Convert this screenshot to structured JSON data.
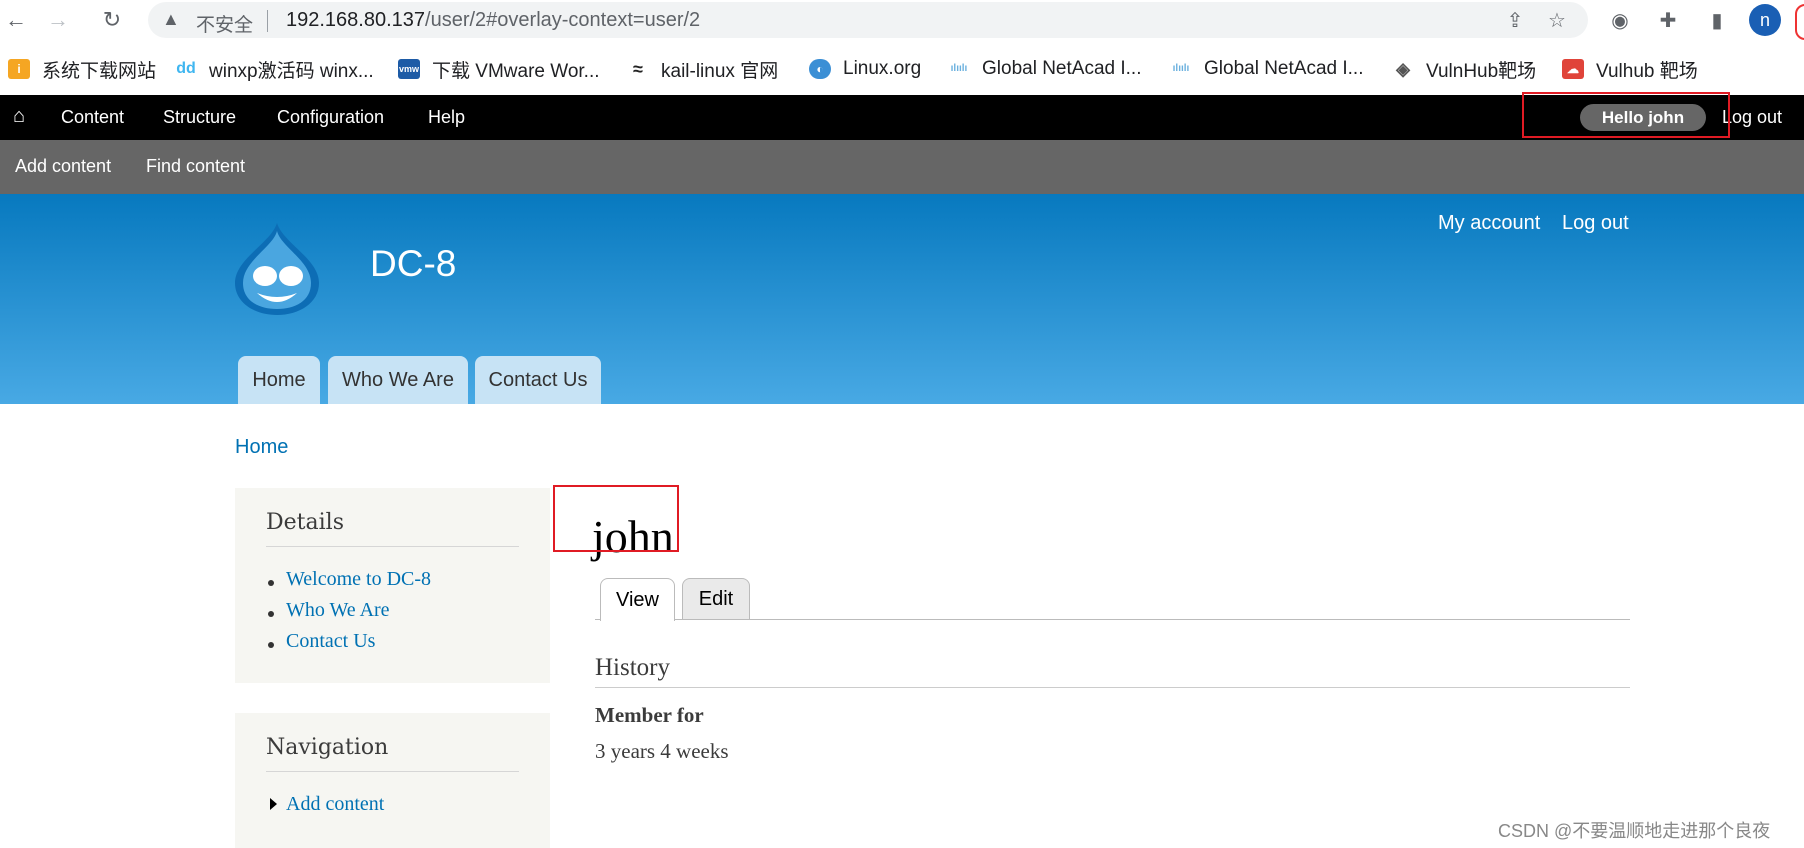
{
  "browser": {
    "insecure_label": "不安全",
    "url_host": "192.168.80.137",
    "url_path": "/user/2#overlay-context=user/2",
    "avatar_letter": "n",
    "bookmarks": [
      {
        "label": "系统下载网站",
        "icon": "colorful-logo-icon",
        "color": "#f5a623"
      },
      {
        "label": "winxp激活码 winx...",
        "icon": "dd-logo-icon",
        "color": "#3fb6f0"
      },
      {
        "label": "下载 VMware Wor...",
        "icon": "vmw-logo-icon",
        "color": "#1d5ba6"
      },
      {
        "label": "kail-linux 官网",
        "icon": "kali-dragon-icon",
        "color": "#222222"
      },
      {
        "label": "Linux.org",
        "icon": "globe-icon",
        "color": "#3b8fd5"
      },
      {
        "label": "Global NetAcad I...",
        "icon": "cisco-icon",
        "color": "#6ab0de"
      },
      {
        "label": "Global NetAcad I...",
        "icon": "cisco-icon",
        "color": "#6ab0de"
      },
      {
        "label": "VulnHub靶场",
        "icon": "vulnhub-icon",
        "color": "#555555"
      },
      {
        "label": "Vulhub 靶场",
        "icon": "vulhub-icon",
        "color": "#e0443a"
      }
    ]
  },
  "toolbar": {
    "items": [
      "Content",
      "Structure",
      "Configuration",
      "Help"
    ],
    "hello_prefix": "Hello",
    "hello_user": "john",
    "logout": "Log out"
  },
  "shortcuts": [
    "Add content",
    "Find content"
  ],
  "header": {
    "site_name": "DC-8",
    "secondary": [
      "My account",
      "Log out"
    ],
    "tabs": [
      "Home",
      "Who We Are",
      "Contact Us"
    ]
  },
  "breadcrumb": "Home",
  "sidebar": {
    "details": {
      "title": "Details",
      "items": [
        "Welcome to DC-8",
        "Who We Are",
        "Contact Us"
      ]
    },
    "navigation": {
      "title": "Navigation",
      "items": [
        "Add content"
      ]
    }
  },
  "main": {
    "title": "john",
    "tabs": [
      "View",
      "Edit"
    ],
    "history_title": "History",
    "member_label": "Member for",
    "member_value": "3 years 4 weeks"
  },
  "watermark": "CSDN @不要温顺地走进那个良夜",
  "colors": {
    "highlight": "#e01b24",
    "link": "#0071b3",
    "toolbar": "#000000",
    "shortcuts": "#666666"
  }
}
